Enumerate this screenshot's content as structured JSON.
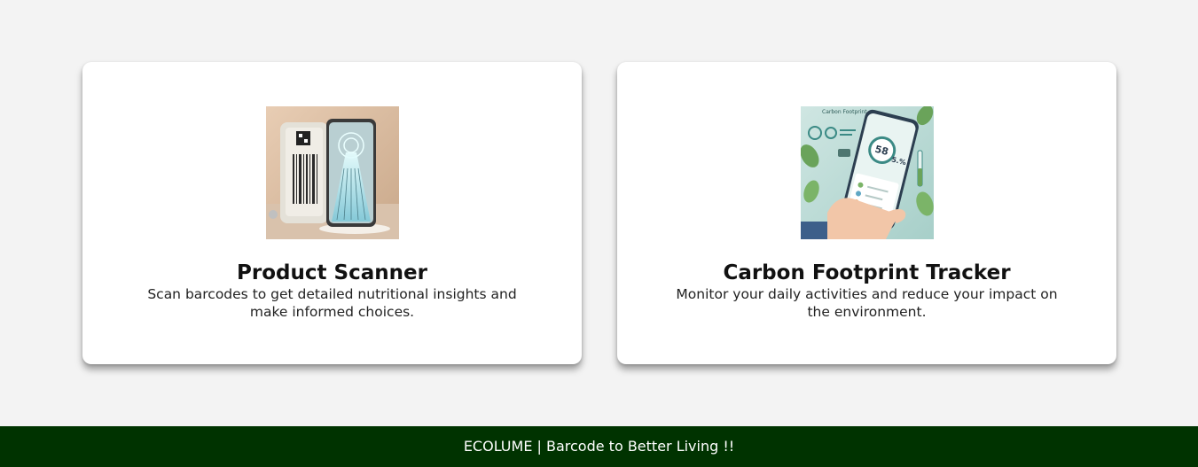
{
  "cards": [
    {
      "title": "Product Scanner",
      "description": "Scan barcodes to get detailed nutritional insights and make informed choices.",
      "image_icon": "barcode-scanner-phone-illustration"
    },
    {
      "title": "Carbon Footprint Tracker",
      "description": "Monitor your daily activities and reduce your impact on the environment.",
      "image_icon": "carbon-tracker-phone-illustration",
      "image_caption": "Carbon Footprint",
      "image_reading": "58",
      "image_percent": "5.%"
    }
  ],
  "footer": {
    "text": "ECOLUME | Barcode to Better Living !!"
  },
  "colors": {
    "background": "#f3f3f3",
    "card": "#ffffff",
    "footer": "#003300",
    "footer_text": "#ffffff"
  }
}
